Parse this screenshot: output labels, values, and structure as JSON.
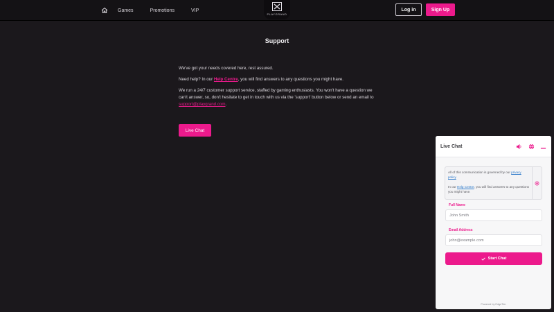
{
  "header": {
    "nav": [
      {
        "label": "Games"
      },
      {
        "label": "Promotions"
      },
      {
        "label": "VIP"
      }
    ],
    "logo_text": "PLAYGRAND",
    "login_label": "Log in",
    "signup_label": "Sign Up"
  },
  "page": {
    "title": "Support",
    "p1": "We've got your needs covered here, rest assured.",
    "p2_before": "Need help? In our ",
    "p2_link": "Help Centre",
    "p2_after": ", you will find answers to any questions you might have.",
    "p3_before": "We run a 24/7 customer support service, staffed by gaming enthusiasts. You won't have a question we can't answer, so, don't hesitate to get in touch with us via the 'support' button below or send an email to ",
    "p3_link": "support@playgrand.com",
    "p3_after": ".",
    "livechat_label": "Live Chat"
  },
  "chat": {
    "title": "Live Chat",
    "notice_line1": "All of this communication is governed by our ",
    "notice_link1": "privacy policy",
    "notice_line2_before": "In our ",
    "notice_link2": "Help Centre",
    "notice_line2_after": ", you will find answers to any questions you might have.",
    "name_label": "Full Name",
    "name_placeholder": "John Smith",
    "email_label": "Email Address",
    "email_placeholder": "john@example.com",
    "start_label": "Start Chat",
    "powered": "Powered by EdgeTier"
  },
  "colors": {
    "accent": "#ec1a8c",
    "background": "#1b181c",
    "header": "#141215",
    "link_blue": "#2a78c9"
  },
  "icons": {
    "home": "home-icon",
    "sound": "speaker-icon",
    "language": "globe-icon",
    "minimize": "minimize-icon",
    "check": "check-icon",
    "scroll": "scroll-indicator-icon"
  }
}
